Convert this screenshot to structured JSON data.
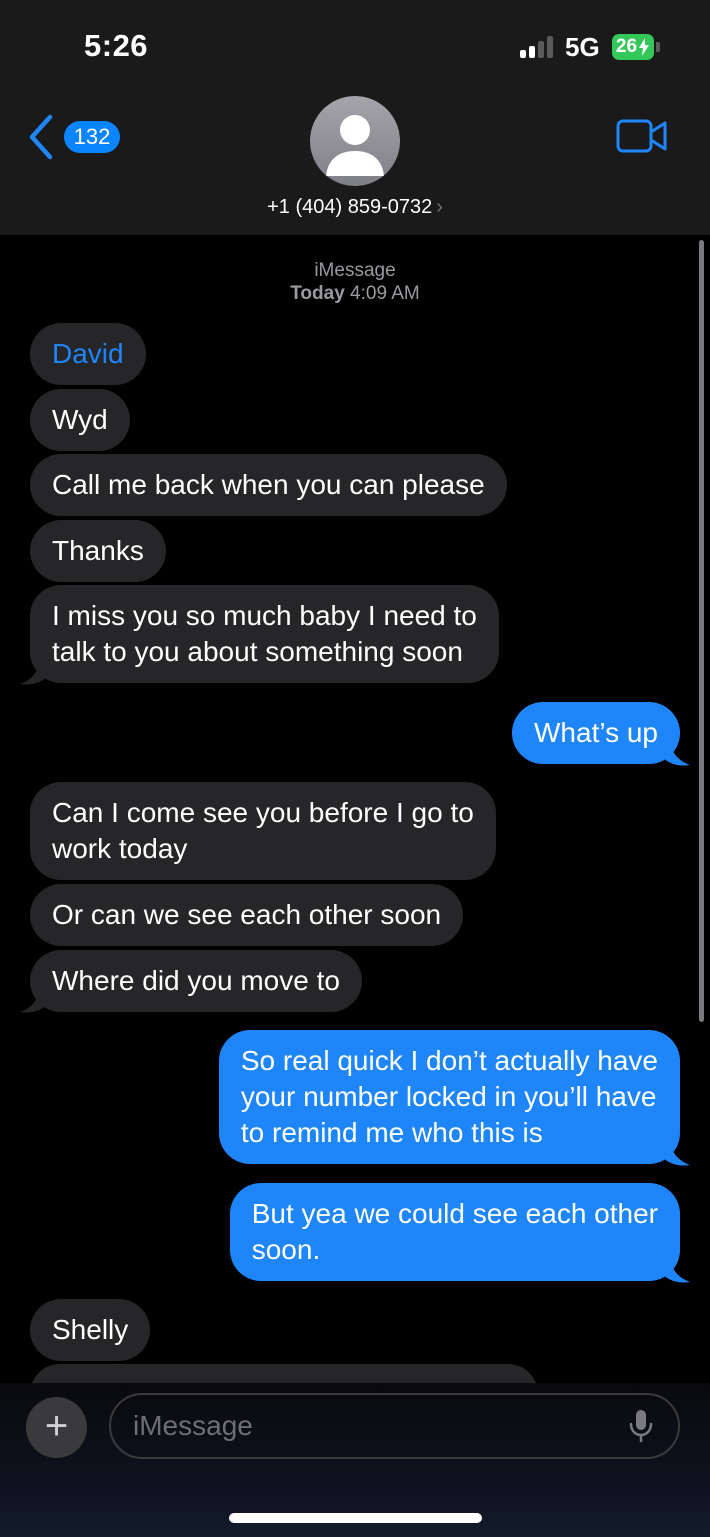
{
  "status_bar": {
    "time": "5:26",
    "network": "5G",
    "battery": "26"
  },
  "nav": {
    "back_badge": "132",
    "contact_number": "+1 (404) 859-0732",
    "contact_chevron": "›"
  },
  "conversation": {
    "service": "iMessage",
    "timestamp_day": "Today",
    "timestamp_time": "4:09 AM",
    "messages": [
      {
        "from": "received",
        "lines": [
          "David"
        ]
      },
      {
        "from": "received",
        "lines": [
          "Wyd"
        ]
      },
      {
        "from": "received",
        "lines": [
          "Call me back when you can please"
        ]
      },
      {
        "from": "received",
        "lines": [
          "Thanks"
        ]
      },
      {
        "from": "received",
        "lines": [
          "I miss you so much baby I need to",
          "talk to you about something soon"
        ]
      },
      {
        "from": "sent",
        "lines": [
          "What’s up"
        ]
      },
      {
        "from": "received",
        "lines": [
          "Can I come see you before I go to",
          "work today"
        ]
      },
      {
        "from": "received",
        "lines": [
          "Or can we see each other soon"
        ]
      },
      {
        "from": "received",
        "lines": [
          "Where did you move to"
        ]
      },
      {
        "from": "sent",
        "lines": [
          "So real quick I don’t actually have",
          "your number locked in you’ll have",
          "to remind me who this is"
        ]
      },
      {
        "from": "sent",
        "lines": [
          "But yea we could see each other",
          "soon."
        ]
      },
      {
        "from": "received",
        "lines": [
          "Shelly"
        ]
      }
    ]
  },
  "composer": {
    "placeholder": "iMessage",
    "plus_label": "+"
  },
  "icons": {
    "back": "chevron-left-icon",
    "avatar": "person-icon",
    "video": "video-camera-icon",
    "mic": "microphone-icon"
  },
  "colors": {
    "accent": "#1e86fa",
    "received_bubble": "#262628",
    "battery": "#34c759"
  }
}
